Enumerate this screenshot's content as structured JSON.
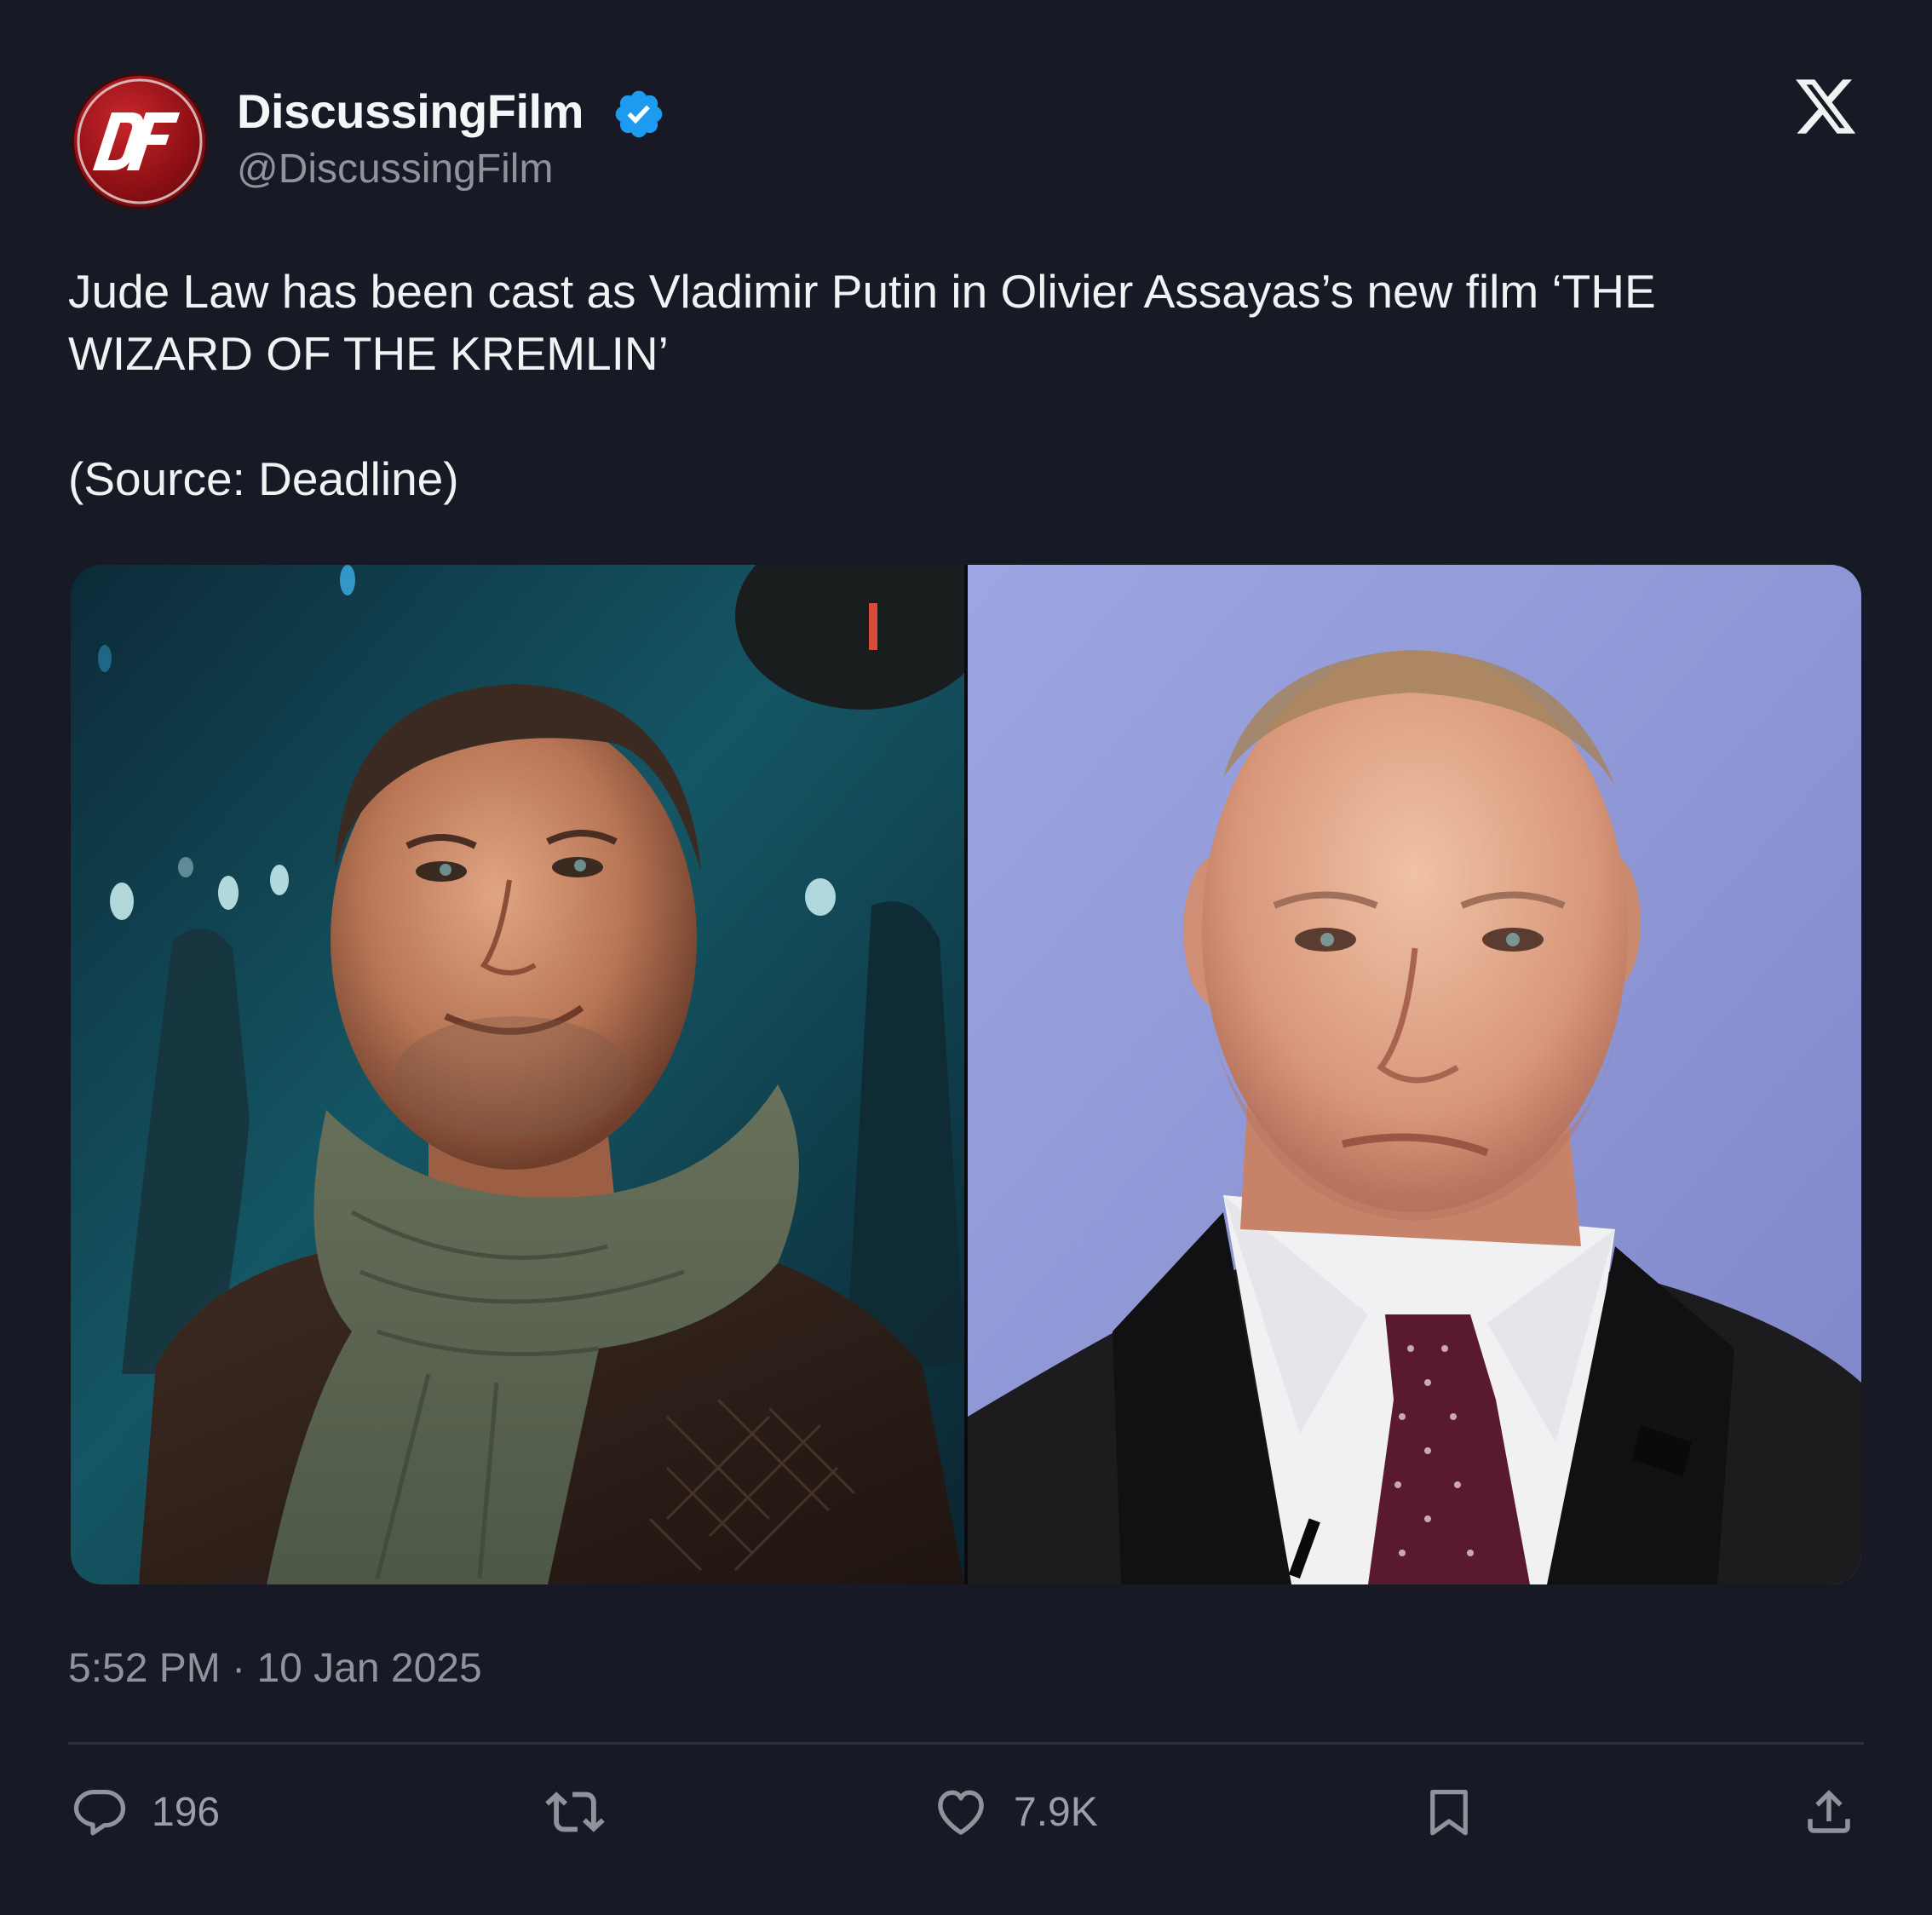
{
  "author": {
    "display_name": "DiscussingFilm",
    "handle": "@DiscussingFilm",
    "verified": true,
    "avatar_icon": "df-logo-icon",
    "avatar_letters": "DF"
  },
  "platform": {
    "logo_icon": "x-logo-icon"
  },
  "tweet": {
    "text_line1": "Jude Law has been cast as Vladimir Putin in Olivier Assayas’s new film ‘THE",
    "text_line2": "WIZARD OF THE KREMLIN’",
    "source": "(Source: Deadline)"
  },
  "media": {
    "images": [
      {
        "subject": "jude-law-photo"
      },
      {
        "subject": "vladimir-putin-photo"
      }
    ]
  },
  "timestamp": {
    "time": "5:52 PM",
    "separator": "·",
    "date": "10 Jan 2025"
  },
  "actions": {
    "replies": "196",
    "likes": "7.9K",
    "reply_icon": "reply-icon",
    "retweet_icon": "retweet-icon",
    "like_icon": "heart-icon",
    "bookmark_icon": "bookmark-icon",
    "share_icon": "share-icon"
  },
  "colors": {
    "background": "#171A24",
    "text_primary": "#F1F2F4",
    "text_secondary": "#8E939C",
    "verified_blue": "#1D9BF0",
    "avatar_red": "#8E1015",
    "divider": "#2C303A"
  }
}
